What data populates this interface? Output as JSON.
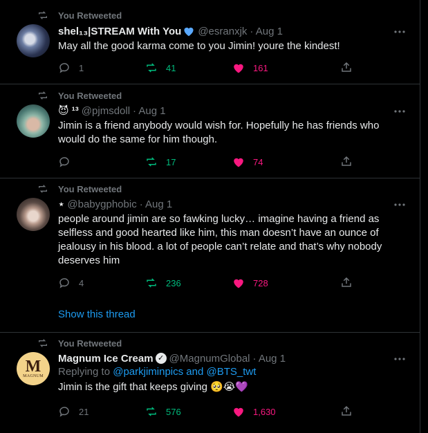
{
  "retweet_label": "You Retweeted",
  "tweets": [
    {
      "name": "shel₁₃|STREAM With You",
      "handle": "@esranxjk",
      "date": "· Aug 1",
      "text": "May all the good karma come to you Jimin! youre the kindest!",
      "replies": "1",
      "retweets": "41",
      "likes": "161"
    },
    {
      "name": "😈 ¹³",
      "handle": "@pjmsdoll",
      "date": "· Aug 1",
      "text": "Jimin is a friend anybody would wish for. Hopefully he has friends who would do the same for him though.",
      "replies": "",
      "retweets": "17",
      "likes": "74"
    },
    {
      "name": "⋆",
      "handle": "@babygphobic",
      "date": "· Aug 1",
      "text": "people around jimin are so fawking lucky… imagine having a friend as selfless and good hearted like him, this man doesn’t have an ounce of jealousy in his blood. a lot of people can’t relate and that’s why nobody deserves him",
      "replies": "4",
      "retweets": "236",
      "likes": "728",
      "show_thread": "Show this thread"
    },
    {
      "name": "Magnum Ice Cream",
      "handle": "@MagnumGlobal",
      "date": "· Aug 1",
      "reply_prefix": "Replying to",
      "reply_links": "@parkjiminpics and @BTS_twt",
      "text": "Jimin is the gift that keeps giving 🥺😭💜",
      "replies": "21",
      "retweets": "576",
      "likes": "1,630",
      "avatar_text": "MAGNUM"
    }
  ],
  "colors": {
    "background": "#000000",
    "retweet_green": "#00ba7c",
    "like_pink": "#f91880",
    "link_blue": "#1d9bf0",
    "muted": "#71767b"
  }
}
